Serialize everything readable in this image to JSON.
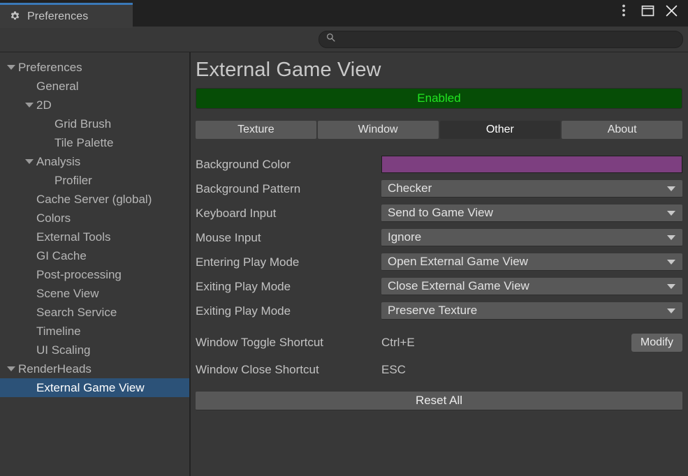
{
  "window": {
    "tab_label": "Preferences",
    "gear_icon": "gear-icon",
    "controls": {
      "menu": "kebab-menu-icon",
      "maximize": "maximize-icon",
      "close": "close-icon"
    }
  },
  "search": {
    "icon": "search-icon",
    "value": "",
    "placeholder": ""
  },
  "sidebar": {
    "items": [
      {
        "label": "Preferences",
        "depth": 0,
        "expanded": true,
        "selected": false
      },
      {
        "label": "General",
        "depth": 1,
        "expanded": null,
        "selected": false
      },
      {
        "label": "2D",
        "depth": 1,
        "expanded": true,
        "selected": false
      },
      {
        "label": "Grid Brush",
        "depth": 2,
        "expanded": null,
        "selected": false
      },
      {
        "label": "Tile Palette",
        "depth": 2,
        "expanded": null,
        "selected": false
      },
      {
        "label": "Analysis",
        "depth": 1,
        "expanded": true,
        "selected": false
      },
      {
        "label": "Profiler",
        "depth": 2,
        "expanded": null,
        "selected": false
      },
      {
        "label": "Cache Server (global)",
        "depth": 1,
        "expanded": null,
        "selected": false
      },
      {
        "label": "Colors",
        "depth": 1,
        "expanded": null,
        "selected": false
      },
      {
        "label": "External Tools",
        "depth": 1,
        "expanded": null,
        "selected": false
      },
      {
        "label": "GI Cache",
        "depth": 1,
        "expanded": null,
        "selected": false
      },
      {
        "label": "Post-processing",
        "depth": 1,
        "expanded": null,
        "selected": false
      },
      {
        "label": "Scene View",
        "depth": 1,
        "expanded": null,
        "selected": false
      },
      {
        "label": "Search Service",
        "depth": 1,
        "expanded": null,
        "selected": false
      },
      {
        "label": "Timeline",
        "depth": 1,
        "expanded": null,
        "selected": false
      },
      {
        "label": "UI Scaling",
        "depth": 1,
        "expanded": null,
        "selected": false
      },
      {
        "label": "RenderHeads",
        "depth": 0,
        "expanded": true,
        "selected": false
      },
      {
        "label": "External Game View",
        "depth": 1,
        "expanded": null,
        "selected": true
      }
    ]
  },
  "main": {
    "title": "External Game View",
    "enabled_button": {
      "label": "Enabled",
      "bg": "#064d06",
      "fg": "#21e521"
    },
    "tabs": [
      {
        "label": "Texture",
        "active": false
      },
      {
        "label": "Window",
        "active": false
      },
      {
        "label": "Other",
        "active": true
      },
      {
        "label": "About",
        "active": false
      }
    ],
    "fields": [
      {
        "label": "Background Color",
        "type": "color",
        "value": "#7d3f80"
      },
      {
        "label": "Background Pattern",
        "type": "dropdown",
        "value": "Checker"
      },
      {
        "label": "Keyboard Input",
        "type": "dropdown",
        "value": "Send to Game View"
      },
      {
        "label": "Mouse Input",
        "type": "dropdown",
        "value": "Ignore"
      },
      {
        "label": "Entering Play Mode",
        "type": "dropdown",
        "value": "Open External Game View"
      },
      {
        "label": "Exiting Play Mode",
        "type": "dropdown",
        "value": "Close External Game View"
      },
      {
        "label": "Exiting Play Mode",
        "type": "dropdown",
        "value": "Preserve Texture"
      }
    ],
    "shortcuts": [
      {
        "label": "Window Toggle Shortcut",
        "value": "Ctrl+E",
        "button": "Modify"
      },
      {
        "label": "Window Close Shortcut",
        "value": "ESC",
        "button": null
      }
    ],
    "reset_label": "Reset All"
  },
  "colors": {
    "selection_blue": "#2c5278",
    "tab_accent": "#3a79b8",
    "panel_bg": "#383838",
    "titlebar_bg": "#212121"
  }
}
